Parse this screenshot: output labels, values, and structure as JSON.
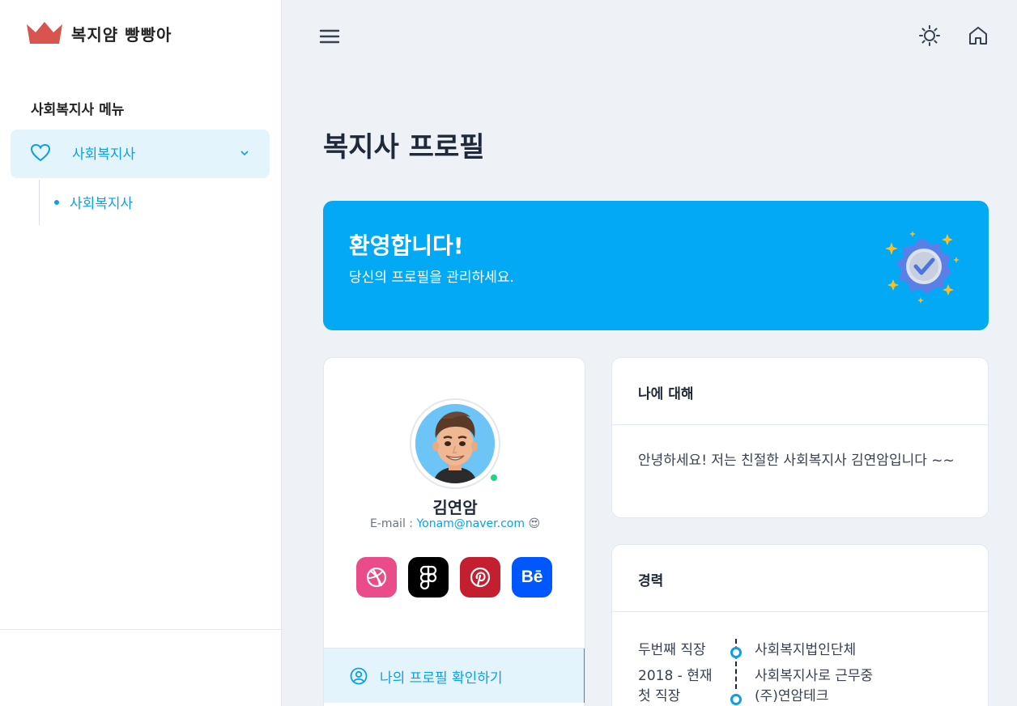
{
  "brand": {
    "name": "복지얌 빵빵아"
  },
  "sidebar": {
    "section_title": "사회복지사 메뉴",
    "menu": {
      "label": "사회복지사",
      "icon": "heart-icon"
    },
    "submenu": [
      {
        "label": "사회복지사"
      }
    ]
  },
  "topbar": {
    "icons": [
      "menu-icon",
      "sun-icon",
      "home-icon"
    ]
  },
  "page": {
    "title": "복지사 프로필"
  },
  "banner": {
    "title": "환영합니다!",
    "subtitle": "당신의 프로필을 관리하세요.",
    "bg_color": "#03a9f4"
  },
  "profile": {
    "name": "김연암",
    "email_prefix": "E-mail : ",
    "email": "Yonam@naver.com",
    "email_emoji": "😍",
    "socials": [
      {
        "name": "dribbble",
        "color": "#ea4c89"
      },
      {
        "name": "figma",
        "color": "#000000"
      },
      {
        "name": "pinterest",
        "color": "#c41f2e"
      },
      {
        "name": "behance",
        "label": "Bē",
        "color": "#0057ff"
      }
    ],
    "tab_label": "나의 프로필 확인하기"
  },
  "about": {
    "title": "나에 대해",
    "text": "안녕하세요! 저는 친절한 사회복지사 김연암입니다 ~~"
  },
  "career": {
    "title": "경력",
    "entries": [
      {
        "left_top": "두번째 직장",
        "left_bottom": "2018 - 현재",
        "right_top": "사회복지법인단체",
        "right_bottom": "사회복지사로 근무중"
      },
      {
        "left_top": "첫 직장",
        "right_top": "(주)연암테크"
      }
    ]
  },
  "accent_color": "#0aa0e8"
}
